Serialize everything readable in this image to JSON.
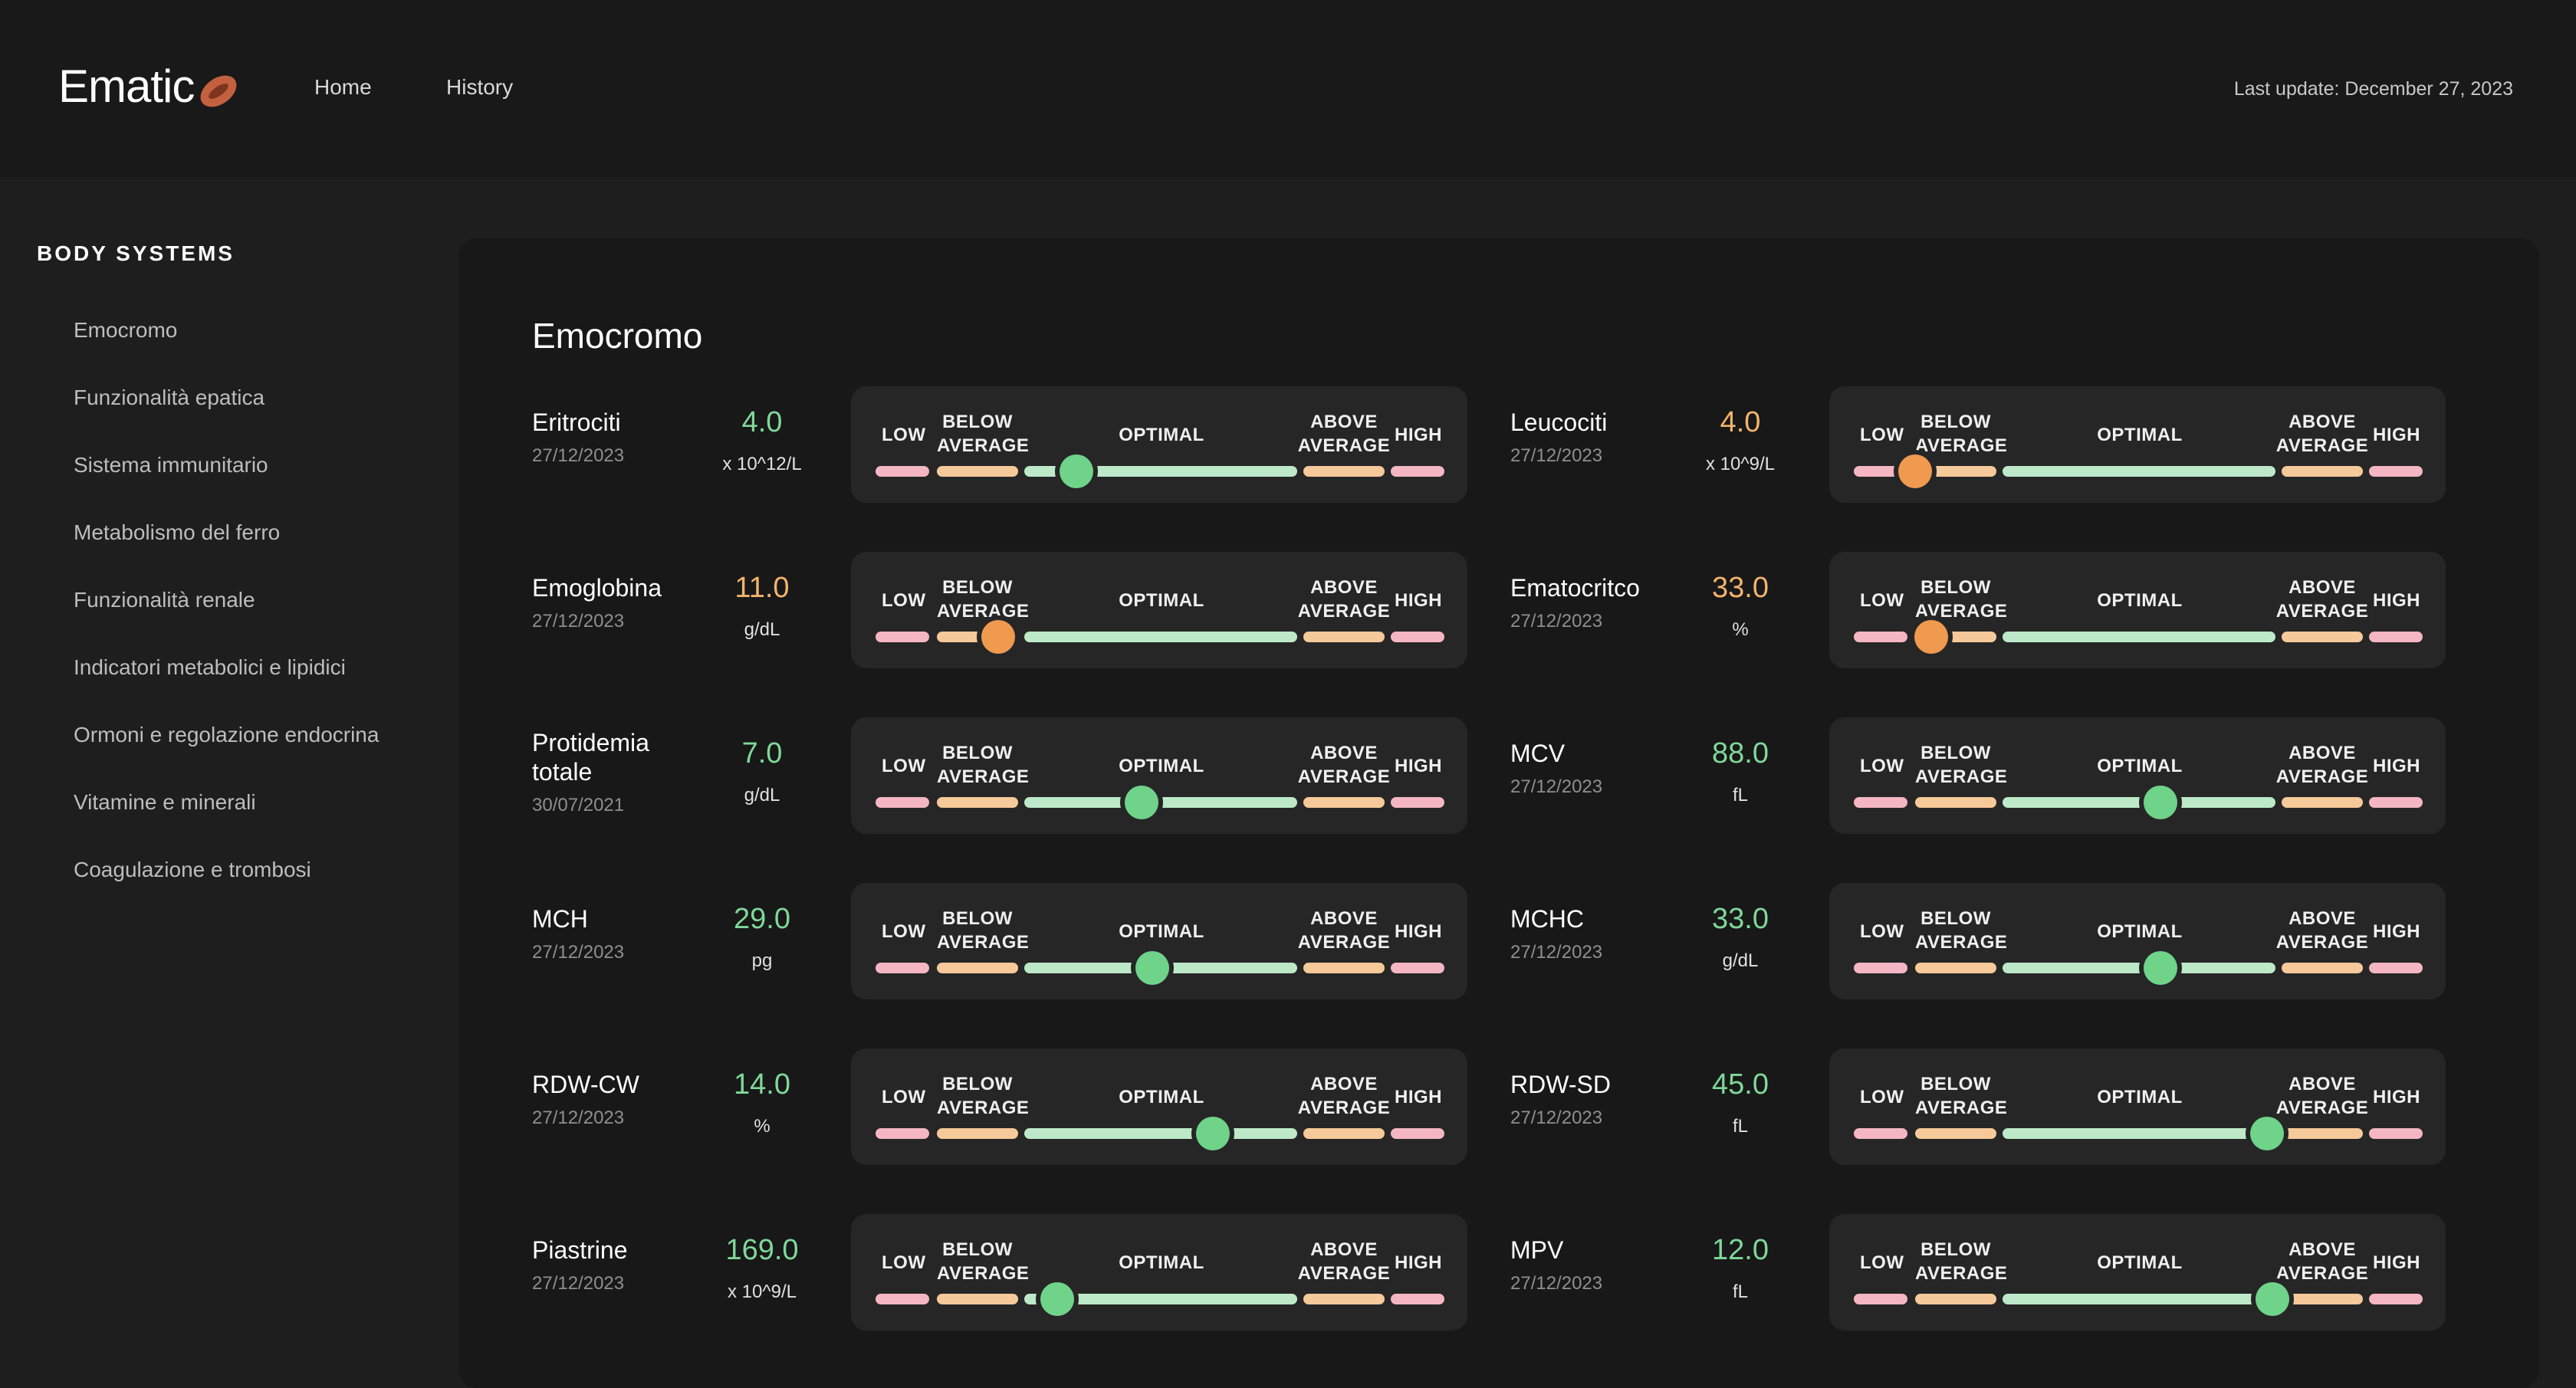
{
  "app": {
    "logo": "Ematic",
    "nav": [
      {
        "label": "Home"
      },
      {
        "label": "History"
      }
    ],
    "last_update": "Last update: December 27, 2023"
  },
  "colors": {
    "optimal_value": "#7fd89a",
    "borderline_value": "#f2b46d",
    "knob_green": "#6fd38a",
    "knob_orange": "#ef9a4f",
    "low_segment": "#f4b6c2",
    "below_segment": "#f6c99a",
    "optimal_segment": "#bde9c9"
  },
  "sidebar": {
    "title": "BODY SYSTEMS",
    "items": [
      {
        "label": "Emocromo"
      },
      {
        "label": "Funzionalità epatica"
      },
      {
        "label": "Sistema immunitario"
      },
      {
        "label": "Metabolismo del ferro"
      },
      {
        "label": "Funzionalità renale"
      },
      {
        "label": "Indicatori metabolici e lipidici"
      },
      {
        "label": "Ormoni e regolazione endocrina"
      },
      {
        "label": "Vitamine e minerali"
      },
      {
        "label": "Coagulazione e trombosi"
      }
    ]
  },
  "main": {
    "title": "Emocromo",
    "gauge_labels": {
      "low": "LOW",
      "below": "BELOW\nAVERAGE",
      "optimal": "OPTIMAL",
      "above": "ABOVE\nAVERAGE",
      "high": "HIGH"
    },
    "metrics": [
      {
        "name": "Eritrociti",
        "date": "27/12/2023",
        "value": "4.0",
        "unit": "x 10^12/L",
        "status": "optimal",
        "level": 0.19
      },
      {
        "name": "Leucociti",
        "date": "27/12/2023",
        "value": "4.0",
        "unit": "x 10^9/L",
        "status": "below",
        "level": 0.0
      },
      {
        "name": "Emoglobina",
        "date": "27/12/2023",
        "value": "11.0",
        "unit": "g/dL",
        "status": "below",
        "level": 0.75
      },
      {
        "name": "Ematocritco",
        "date": "27/12/2023",
        "value": "33.0",
        "unit": "%",
        "status": "below",
        "level": 0.2
      },
      {
        "name": "Protidemia totale",
        "date": "30/07/2021",
        "value": "7.0",
        "unit": "g/dL",
        "status": "optimal",
        "level": 0.43
      },
      {
        "name": "MCV",
        "date": "27/12/2023",
        "value": "88.0",
        "unit": "fL",
        "status": "optimal",
        "level": 0.58
      },
      {
        "name": "MCH",
        "date": "27/12/2023",
        "value": "29.0",
        "unit": "pg",
        "status": "optimal",
        "level": 0.47
      },
      {
        "name": "MCHC",
        "date": "27/12/2023",
        "value": "33.0",
        "unit": "g/dL",
        "status": "optimal",
        "level": 0.58
      },
      {
        "name": "RDW-CW",
        "date": "27/12/2023",
        "value": "14.0",
        "unit": "%",
        "status": "optimal",
        "level": 0.69
      },
      {
        "name": "RDW-SD",
        "date": "27/12/2023",
        "value": "45.0",
        "unit": "fL",
        "status": "optimal",
        "level": 0.97
      },
      {
        "name": "Piastrine",
        "date": "27/12/2023",
        "value": "169.0",
        "unit": "x 10^9/L",
        "status": "optimal",
        "level": 0.12
      },
      {
        "name": "MPV",
        "date": "27/12/2023",
        "value": "12.0",
        "unit": "fL",
        "status": "optimal",
        "level": 0.99
      }
    ]
  }
}
